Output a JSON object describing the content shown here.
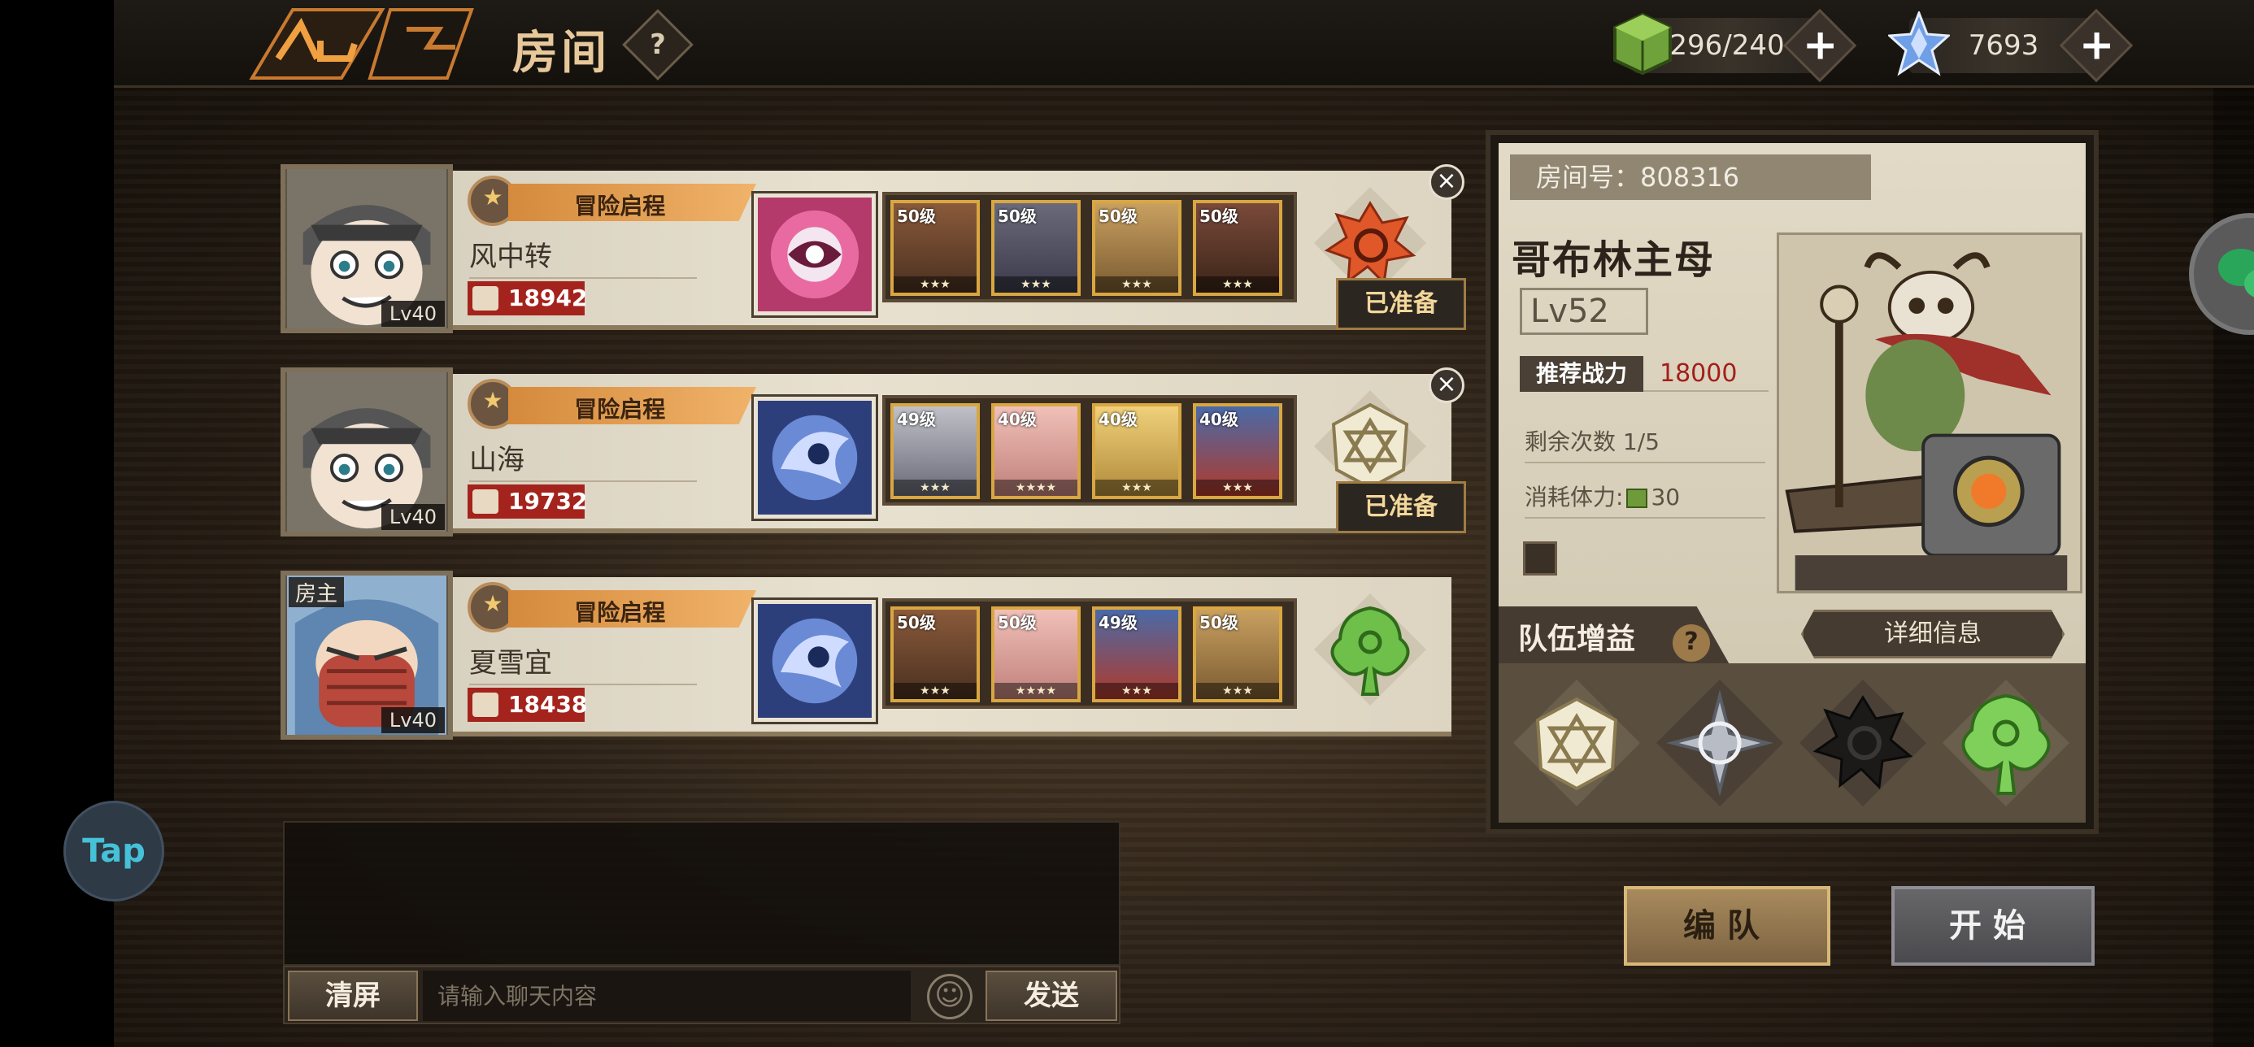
{
  "header": {
    "title": "房间",
    "help": "?"
  },
  "resources": {
    "stamina": {
      "value": "296/240",
      "plus": "+"
    },
    "gems": {
      "value": "7693",
      "plus": "+"
    }
  },
  "players": [
    {
      "name": "风中转",
      "badge": "冒险启程",
      "level": "Lv40",
      "power": "18942",
      "hero_levels": [
        "50级",
        "50级",
        "50级",
        "50级"
      ],
      "ready": "已准备",
      "close": "×"
    },
    {
      "name": "山海",
      "badge": "冒险启程",
      "level": "Lv40",
      "power": "19732",
      "hero_levels": [
        "49级",
        "40级",
        "40级",
        "40级"
      ],
      "ready": "已准备",
      "close": "×"
    },
    {
      "name": "夏雪宜",
      "badge": "冒险启程",
      "level": "Lv40",
      "power": "18438",
      "host": "房主",
      "hero_levels": [
        "50级",
        "50级",
        "49级",
        "50级"
      ]
    }
  ],
  "room": {
    "number_label": "房间号：808316",
    "boss_name": "哥布林主母",
    "boss_level": "Lv52",
    "recommended_label": "推荐战力",
    "recommended_value": "18000",
    "remaining": "剩余次数 1/5",
    "stamina_cost_label": "消耗体力:",
    "stamina_cost_value": "30",
    "buff_label": "队伍增益",
    "buff_help": "?",
    "detail_button": "详细信息"
  },
  "chat": {
    "clear": "清屏",
    "placeholder": "请输入聊天内容",
    "send": "发送"
  },
  "actions": {
    "team": "编队",
    "start": "开始"
  },
  "overlay": {
    "tap": "Tap"
  },
  "colors": {
    "accent_orange": "#e8a050",
    "power_red": "#a4231d",
    "panel_bg": "#e2dac6"
  }
}
